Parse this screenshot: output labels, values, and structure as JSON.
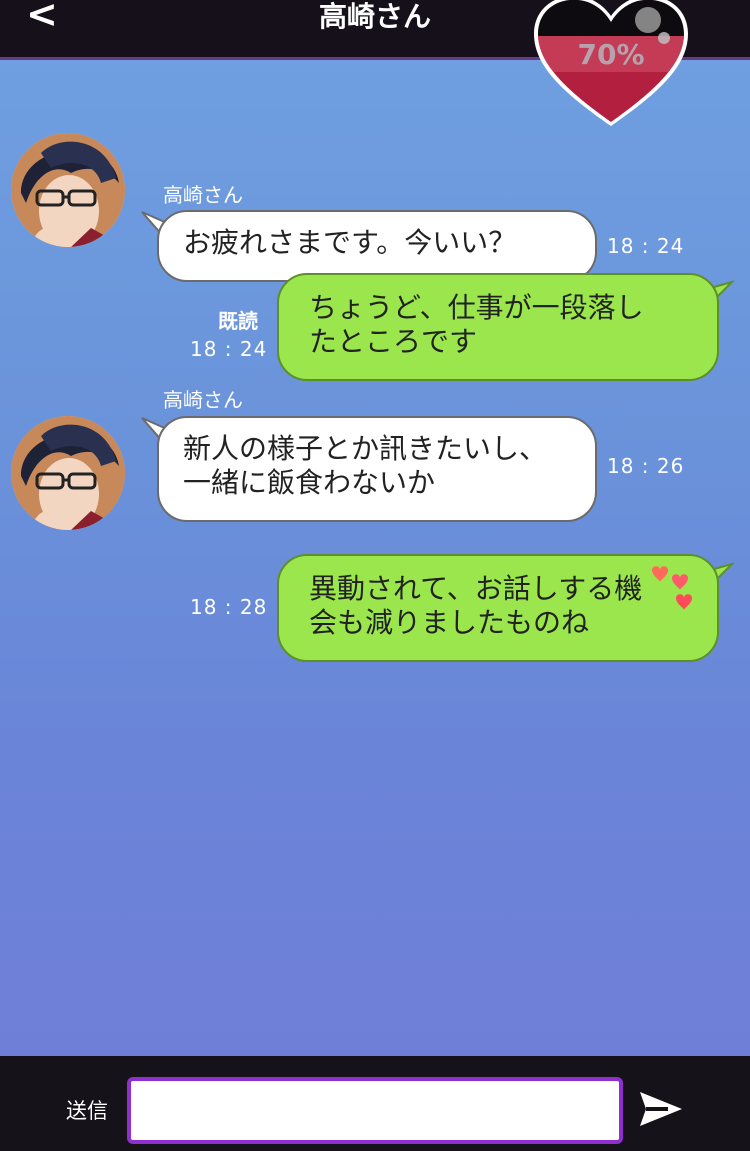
{
  "header": {
    "back_label": "<",
    "title": "高崎さん",
    "affection": "70%"
  },
  "messages": [
    {
      "direction": "in",
      "sender": "高崎さん",
      "lines": [
        "お疲れさまです。今いい？"
      ],
      "time": "18 : 24"
    },
    {
      "direction": "out",
      "read": "既読",
      "lines": [
        "ちょうど、仕事が一段落し",
        "たところです"
      ],
      "time": "18 : 24"
    },
    {
      "direction": "in",
      "sender": "高崎さん",
      "lines": [
        "新人の様子とか訊きたいし、",
        "一緒に飯食わないか"
      ],
      "time": "18 : 26"
    },
    {
      "direction": "out",
      "lines": [
        "異動されて、お話しする機",
        "会も減りましたものね"
      ],
      "time": "18 : 28"
    }
  ],
  "footer": {
    "send_label": "送信",
    "input_value": "",
    "input_placeholder": ""
  },
  "icons": {
    "back": "chevron-left-icon",
    "heart": "heart-icon",
    "send": "send-arrow-icon"
  },
  "colors": {
    "outgoing_bubble": "#9be64c",
    "incoming_bubble": "#ffffff",
    "input_border": "#8f2fcf",
    "heart_fill": "#b3203f"
  }
}
